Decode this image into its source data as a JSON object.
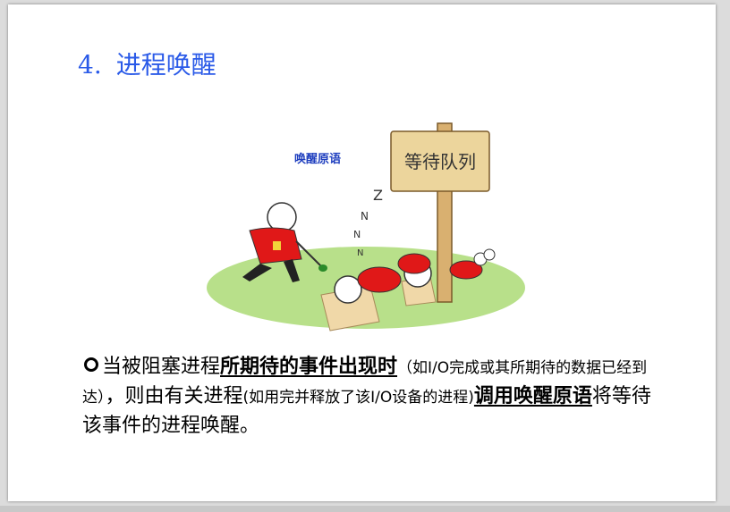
{
  "slide": {
    "title_number": "4.",
    "title_text": "进程唤醒",
    "illustration": {
      "label_primitive": "唤醒原语",
      "sign_text": "等待队列",
      "sleep_marks": "Z",
      "sleep_marks_small": "N"
    },
    "body": {
      "seg1": "当被阻塞进程",
      "seg2_underlined": "所期待的事件出现时",
      "seg3_small": "（如I/O完成或其所期待的数据已经到达）",
      "seg4": "，则由有关进程",
      "seg5_small": "(如用完并释放了该I/O设备的进程)",
      "seg6_underlined": "调用唤醒原语",
      "seg7": "将等待该事件的进程唤醒。"
    }
  },
  "colors": {
    "title": "#2a5ae8",
    "label": "#1f3fbf",
    "shirt": "#e01818",
    "grass": "#b8e08a"
  }
}
